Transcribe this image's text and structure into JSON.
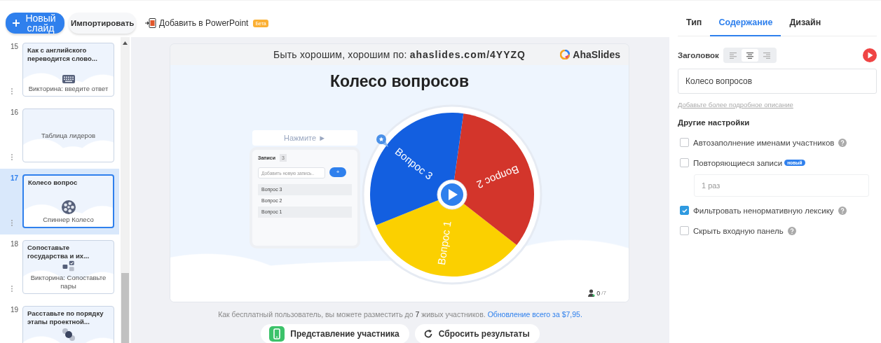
{
  "toolbar": {
    "new_slide_button": "Новый слайд",
    "import_button": "Импортировать",
    "powerpoint_button": "Добавить в PowerPoint",
    "powerpoint_badge": "Бета"
  },
  "slides": [
    {
      "number": "15",
      "title": "Как с английского переводится слово...",
      "kind": "type-answer",
      "caption": "Викторина: введите ответ",
      "selected": false
    },
    {
      "number": "16",
      "kind": "leaderboard",
      "caption": "Таблица лидеров",
      "selected": false
    },
    {
      "number": "17",
      "title": "Колесо вопрос",
      "kind": "spinner",
      "caption": "Спиннер Колесо",
      "selected": true
    },
    {
      "number": "18",
      "title": "Сопоставьте государства и их...",
      "kind": "match",
      "caption": "Викторина: Сопоставьте пары",
      "selected": false
    },
    {
      "number": "19",
      "title": "Расставьте по порядку этапы проектной...",
      "kind": "order",
      "selected": false
    }
  ],
  "preview": {
    "join_text": "Быть хорошим, хорошим по: **ahaslides.com/4YYZQ**",
    "brand": "AhaSlides",
    "title": "Колесо вопросов",
    "spin_button": "Нажмите ►",
    "entries": {
      "label": "Записи",
      "count": "3",
      "placeholder": "Добавить новую запись..",
      "add_button": "+",
      "items": [
        "Вопрос 3",
        "Вопрос 2",
        "Вопрос 1"
      ]
    },
    "wheel": [
      {
        "label": "Вопрос 1",
        "color": "#fbd000"
      },
      {
        "label": "Вопрос 2",
        "color": "#d3352b"
      },
      {
        "label": "Вопрос 3",
        "color": "#135fe0"
      }
    ],
    "participants": {
      "count": "0",
      "max": "/7"
    }
  },
  "upgrade_note": {
    "text": "Как бесплатный пользователь, вы можете разместить до **7** живых участников.",
    "link": "Обновление всего за $7,95."
  },
  "actions": [
    {
      "kind": "participant-view",
      "label": "Представление участника"
    },
    {
      "kind": "reset",
      "label": "Сбросить результаты"
    }
  ],
  "tabs": [
    {
      "label": "Тип",
      "selected": false
    },
    {
      "label": "Содержание",
      "selected": true
    },
    {
      "label": "Дизайн",
      "selected": false
    }
  ],
  "heading": {
    "label": "Заголовок",
    "alignments": [
      {
        "kind": "left",
        "selected": false
      },
      {
        "kind": "center",
        "selected": true
      },
      {
        "kind": "right",
        "selected": false
      }
    ],
    "value": "Колесо вопросов"
  },
  "description_link": "Добавьте более подробное описание",
  "other_settings": {
    "title": "Другие настройки",
    "options": [
      {
        "label": "Автозаполнение именами участников",
        "checked": false,
        "help": true
      },
      {
        "label": "Повторяющиеся записи",
        "checked": false,
        "help": false,
        "badge": "новый",
        "value": "1 раз"
      },
      {
        "label": "Фильтровать ненормативную лексику",
        "checked": true,
        "help": true
      },
      {
        "label": "Скрыть входную панель",
        "checked": false,
        "help": true
      }
    ]
  }
}
